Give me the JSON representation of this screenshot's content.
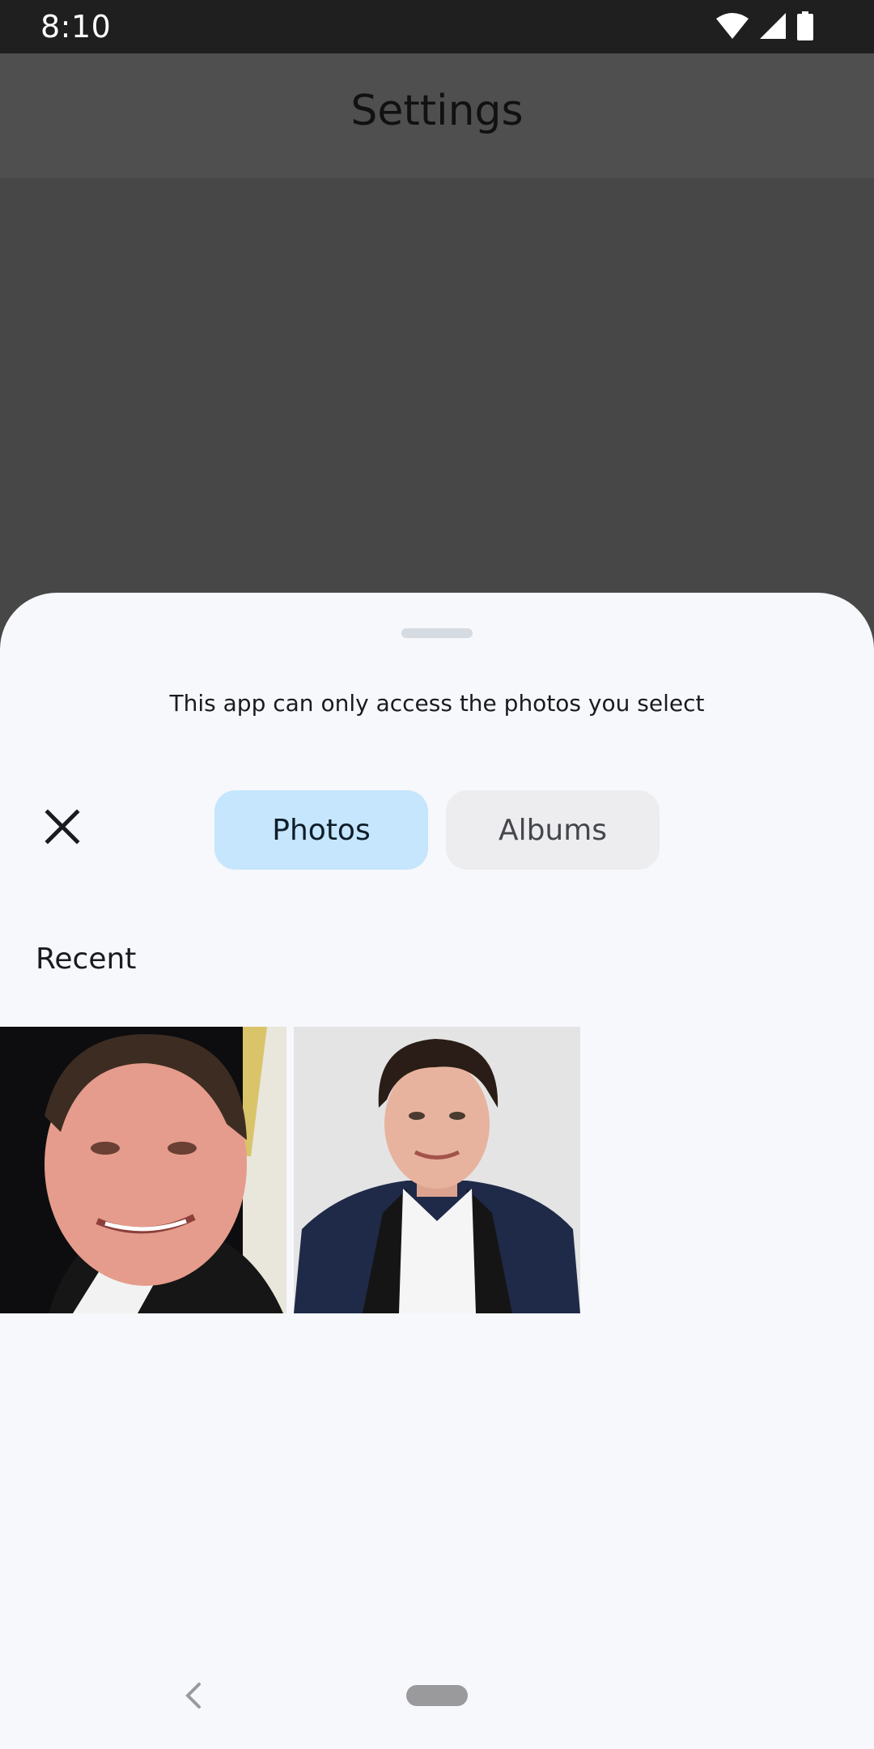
{
  "status_bar": {
    "time": "8:10",
    "icons": [
      "wifi-icon",
      "signal-icon",
      "battery-icon"
    ]
  },
  "app_bar": {
    "title": "Settings"
  },
  "picker": {
    "message": "This app can only access the photos you select",
    "close_icon": "close-icon",
    "tabs": [
      {
        "label": "Photos",
        "selected": true
      },
      {
        "label": "Albums",
        "selected": false
      }
    ],
    "section_title": "Recent",
    "photos": [
      {
        "kind": "portrait-photo",
        "selected": false
      },
      {
        "kind": "portrait-photo",
        "selected": false
      }
    ]
  },
  "nav_bar": {
    "back_icon": "back-chevron-icon",
    "home_icon": "home-pill-icon"
  },
  "colors": {
    "scrim": "#474747",
    "sheet_background": "#f7f8fc",
    "tab_selected": "#c5e6fc",
    "tab_unselected": "#ededef"
  }
}
